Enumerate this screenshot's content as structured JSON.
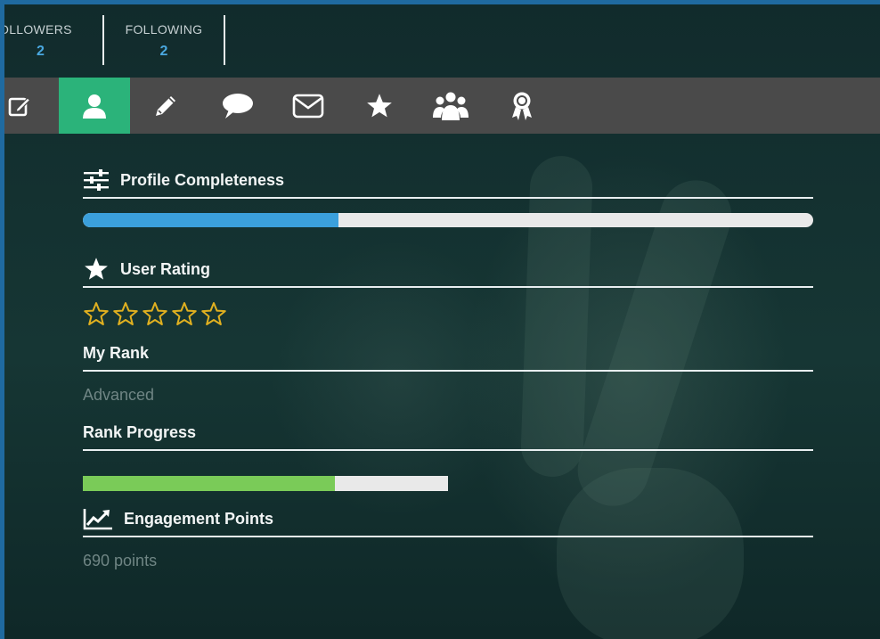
{
  "stats": {
    "followers_label": "OLLOWERS",
    "followers_value": "2",
    "following_label": "FOLLOWING",
    "following_value": "2"
  },
  "tabs": [
    {
      "icon": "edit-icon",
      "active": false
    },
    {
      "icon": "user-icon",
      "active": true
    },
    {
      "icon": "pencil-icon",
      "active": false
    },
    {
      "icon": "comment-icon",
      "active": false
    },
    {
      "icon": "envelope-icon",
      "active": false
    },
    {
      "icon": "star-icon",
      "active": false
    },
    {
      "icon": "users-icon",
      "active": false
    },
    {
      "icon": "award-icon",
      "active": false
    }
  ],
  "profile_completeness": {
    "label": "Profile Completeness",
    "progress": 0.35,
    "color": "#3ba0dc"
  },
  "user_rating": {
    "label": "User Rating",
    "stars_filled": 0,
    "stars_total": 5,
    "star_color": "#e0b020"
  },
  "my_rank": {
    "label": "My Rank",
    "value": "Advanced"
  },
  "rank_progress": {
    "label": "Rank Progress",
    "progress": 0.69,
    "color": "#7acb58"
  },
  "engagement_points": {
    "label": "Engagement Points",
    "value": "690 points"
  },
  "colors": {
    "active_tab": "#2bb37a",
    "tab_bar": "#4a4a4a",
    "accent_blue": "#3ba0dc",
    "accent_green": "#7acb58",
    "stat_number": "#4aa8e0"
  }
}
